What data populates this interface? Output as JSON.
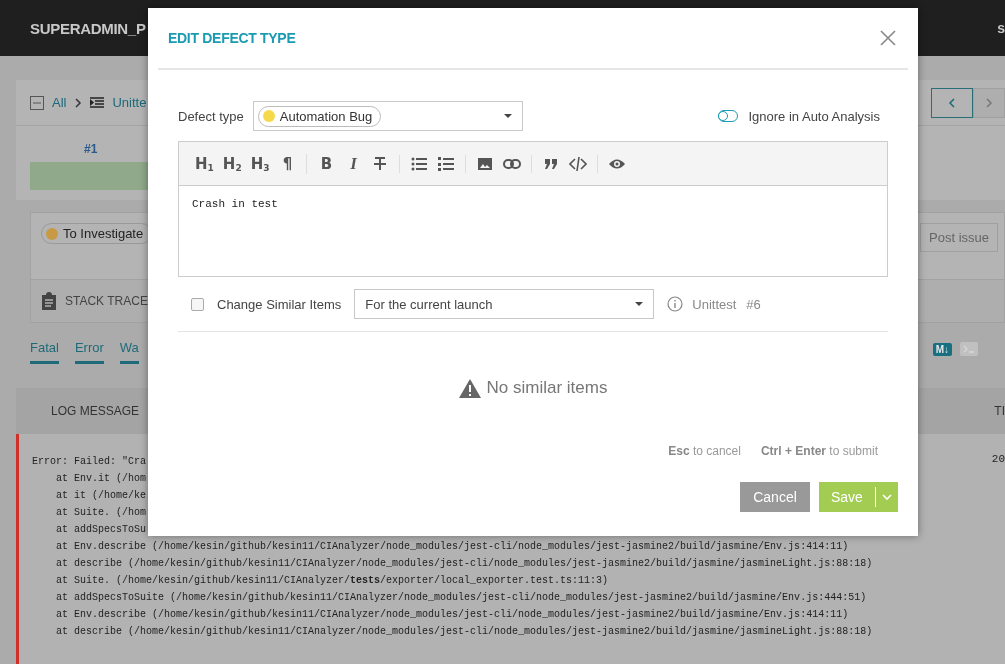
{
  "header": {
    "title": "SUPERADMIN_P",
    "user_initial": "s"
  },
  "breadcrumb": {
    "items": [
      {
        "label": "All"
      },
      {
        "label": "Unitte"
      }
    ]
  },
  "history": {
    "items": [
      {
        "label": "#1"
      }
    ]
  },
  "defect": {
    "type": "To Investigate",
    "post_issue": "Post issue",
    "stack_trace": "STACK TRACE"
  },
  "log_tabs": [
    {
      "label": "Fatal",
      "selected": true
    },
    {
      "label": "Error",
      "selected": true
    },
    {
      "label": "Wa",
      "selected": true
    }
  ],
  "markdown_toggle": "M↓",
  "log_table": {
    "columns": [
      "LOG MESSAGE",
      "TI"
    ],
    "rows": [
      {
        "time": "20",
        "lines": [
          "Error: Failed: \"Cra",
          "    at Env.it (/hom",
          "    at it (/home/ke",
          "    at Suite. (/hom",
          "    at addSpecsToSu",
          "    at Env.describe (/home/kesin/github/kesin11/CIAnalyzer/node_modules/jest-cli/node_modules/jest-jasmine2/build/jasmine/Env.js:414:11)",
          "    at describe (/home/kesin/github/kesin11/CIAnalyzer/node_modules/jest-cli/node_modules/jest-jasmine2/build/jasmine/jasmineLight.js:88:18)",
          "    at Suite. (/home/kesin/github/kesin11/CIAnalyzer/**tests**/exporter/local_exporter.test.ts:11:3)",
          "    at addSpecsToSuite (/home/kesin/github/kesin11/CIAnalyzer/node_modules/jest-cli/node_modules/jest-jasmine2/build/jasmine/Env.js:444:51)",
          "    at Env.describe (/home/kesin/github/kesin11/CIAnalyzer/node_modules/jest-cli/node_modules/jest-jasmine2/build/jasmine/Env.js:414:11)",
          "    at describe (/home/kesin/github/kesin11/CIAnalyzer/node_modules/jest-cli/node_modules/jest-jasmine2/build/jasmine/jasmineLight.js:88:18)"
        ]
      }
    ]
  },
  "modal": {
    "title": "EDIT DEFECT TYPE",
    "defect_type": {
      "label": "Defect type",
      "value": "Automation Bug",
      "color": "#f5d94a"
    },
    "ignore_toggle": {
      "label": "Ignore in Auto Analysis",
      "on": false
    },
    "toolbar": [
      [
        {
          "kind": "heading",
          "text": "H$_{1}$"
        },
        {
          "kind": "heading",
          "text": "H$_{2}$"
        },
        {
          "kind": "heading",
          "text": "H$_{3}$"
        },
        {
          "kind": "glyph",
          "text": "¶"
        }
      ],
      [
        {
          "kind": "bold",
          "text": "B"
        },
        {
          "kind": "italic",
          "text": "I"
        },
        {
          "kind": "strikethrough"
        }
      ],
      [
        {
          "kind": "bullet-list"
        },
        {
          "kind": "numbered-list"
        }
      ],
      [
        {
          "kind": "image"
        },
        {
          "kind": "link"
        }
      ],
      [
        {
          "kind": "quote"
        },
        {
          "kind": "code"
        }
      ],
      [
        {
          "kind": "preview"
        }
      ]
    ],
    "comment": "Crash in test",
    "similar": {
      "checked": false,
      "label": "Change Similar Items",
      "scope": "For the current launch",
      "launch": "Unittest",
      "number": "#6"
    },
    "empty_message": "No similar items",
    "hints": [
      {
        "key": "Esc",
        "text": " to cancel"
      },
      {
        "key": "Ctrl + Enter",
        "text": " to submit"
      }
    ],
    "cancel": "Cancel",
    "save": "Save"
  }
}
